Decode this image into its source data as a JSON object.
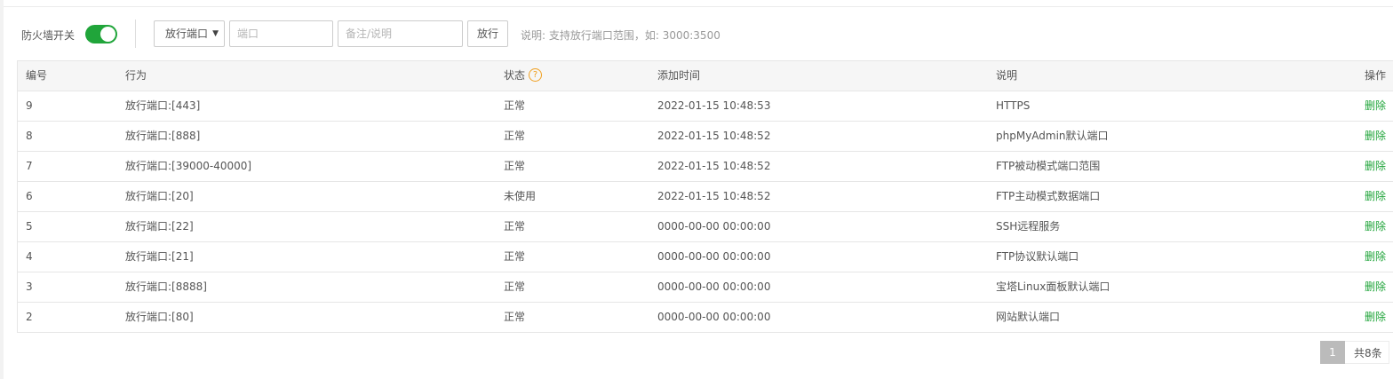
{
  "toolbar": {
    "firewall_label": "防火墙开关",
    "firewall_on": true,
    "type_select": "放行端口",
    "port_placeholder": "端口",
    "note_placeholder": "备注/说明",
    "allow_button": "放行",
    "hint": "说明: 支持放行端口范围，如: 3000:3500"
  },
  "colors": {
    "accent": "#20a53a",
    "help": "#f0a020"
  },
  "table": {
    "headers": {
      "id": "编号",
      "action": "行为",
      "status": "状态",
      "time": "添加时间",
      "note": "说明",
      "op": "操作"
    },
    "status_help_icon": "question-circle-icon",
    "rows": [
      {
        "id": "9",
        "action": "放行端口:[443]",
        "status": "正常",
        "time": "2022-01-15 10:48:53",
        "note": "HTTPS",
        "op": "删除"
      },
      {
        "id": "8",
        "action": "放行端口:[888]",
        "status": "正常",
        "time": "2022-01-15 10:48:52",
        "note": "phpMyAdmin默认端口",
        "op": "删除"
      },
      {
        "id": "7",
        "action": "放行端口:[39000-40000]",
        "status": "正常",
        "time": "2022-01-15 10:48:52",
        "note": "FTP被动模式端口范围",
        "op": "删除"
      },
      {
        "id": "6",
        "action": "放行端口:[20]",
        "status": "未使用",
        "time": "2022-01-15 10:48:52",
        "note": "FTP主动模式数据端口",
        "op": "删除"
      },
      {
        "id": "5",
        "action": "放行端口:[22]",
        "status": "正常",
        "time": "0000-00-00 00:00:00",
        "note": "SSH远程服务",
        "op": "删除"
      },
      {
        "id": "4",
        "action": "放行端口:[21]",
        "status": "正常",
        "time": "0000-00-00 00:00:00",
        "note": "FTP协议默认端口",
        "op": "删除"
      },
      {
        "id": "3",
        "action": "放行端口:[8888]",
        "status": "正常",
        "time": "0000-00-00 00:00:00",
        "note": "宝塔Linux面板默认端口",
        "op": "删除"
      },
      {
        "id": "2",
        "action": "放行端口:[80]",
        "status": "正常",
        "time": "0000-00-00 00:00:00",
        "note": "网站默认端口",
        "op": "删除"
      }
    ]
  },
  "pager": {
    "current": "1",
    "total": "共8条"
  }
}
